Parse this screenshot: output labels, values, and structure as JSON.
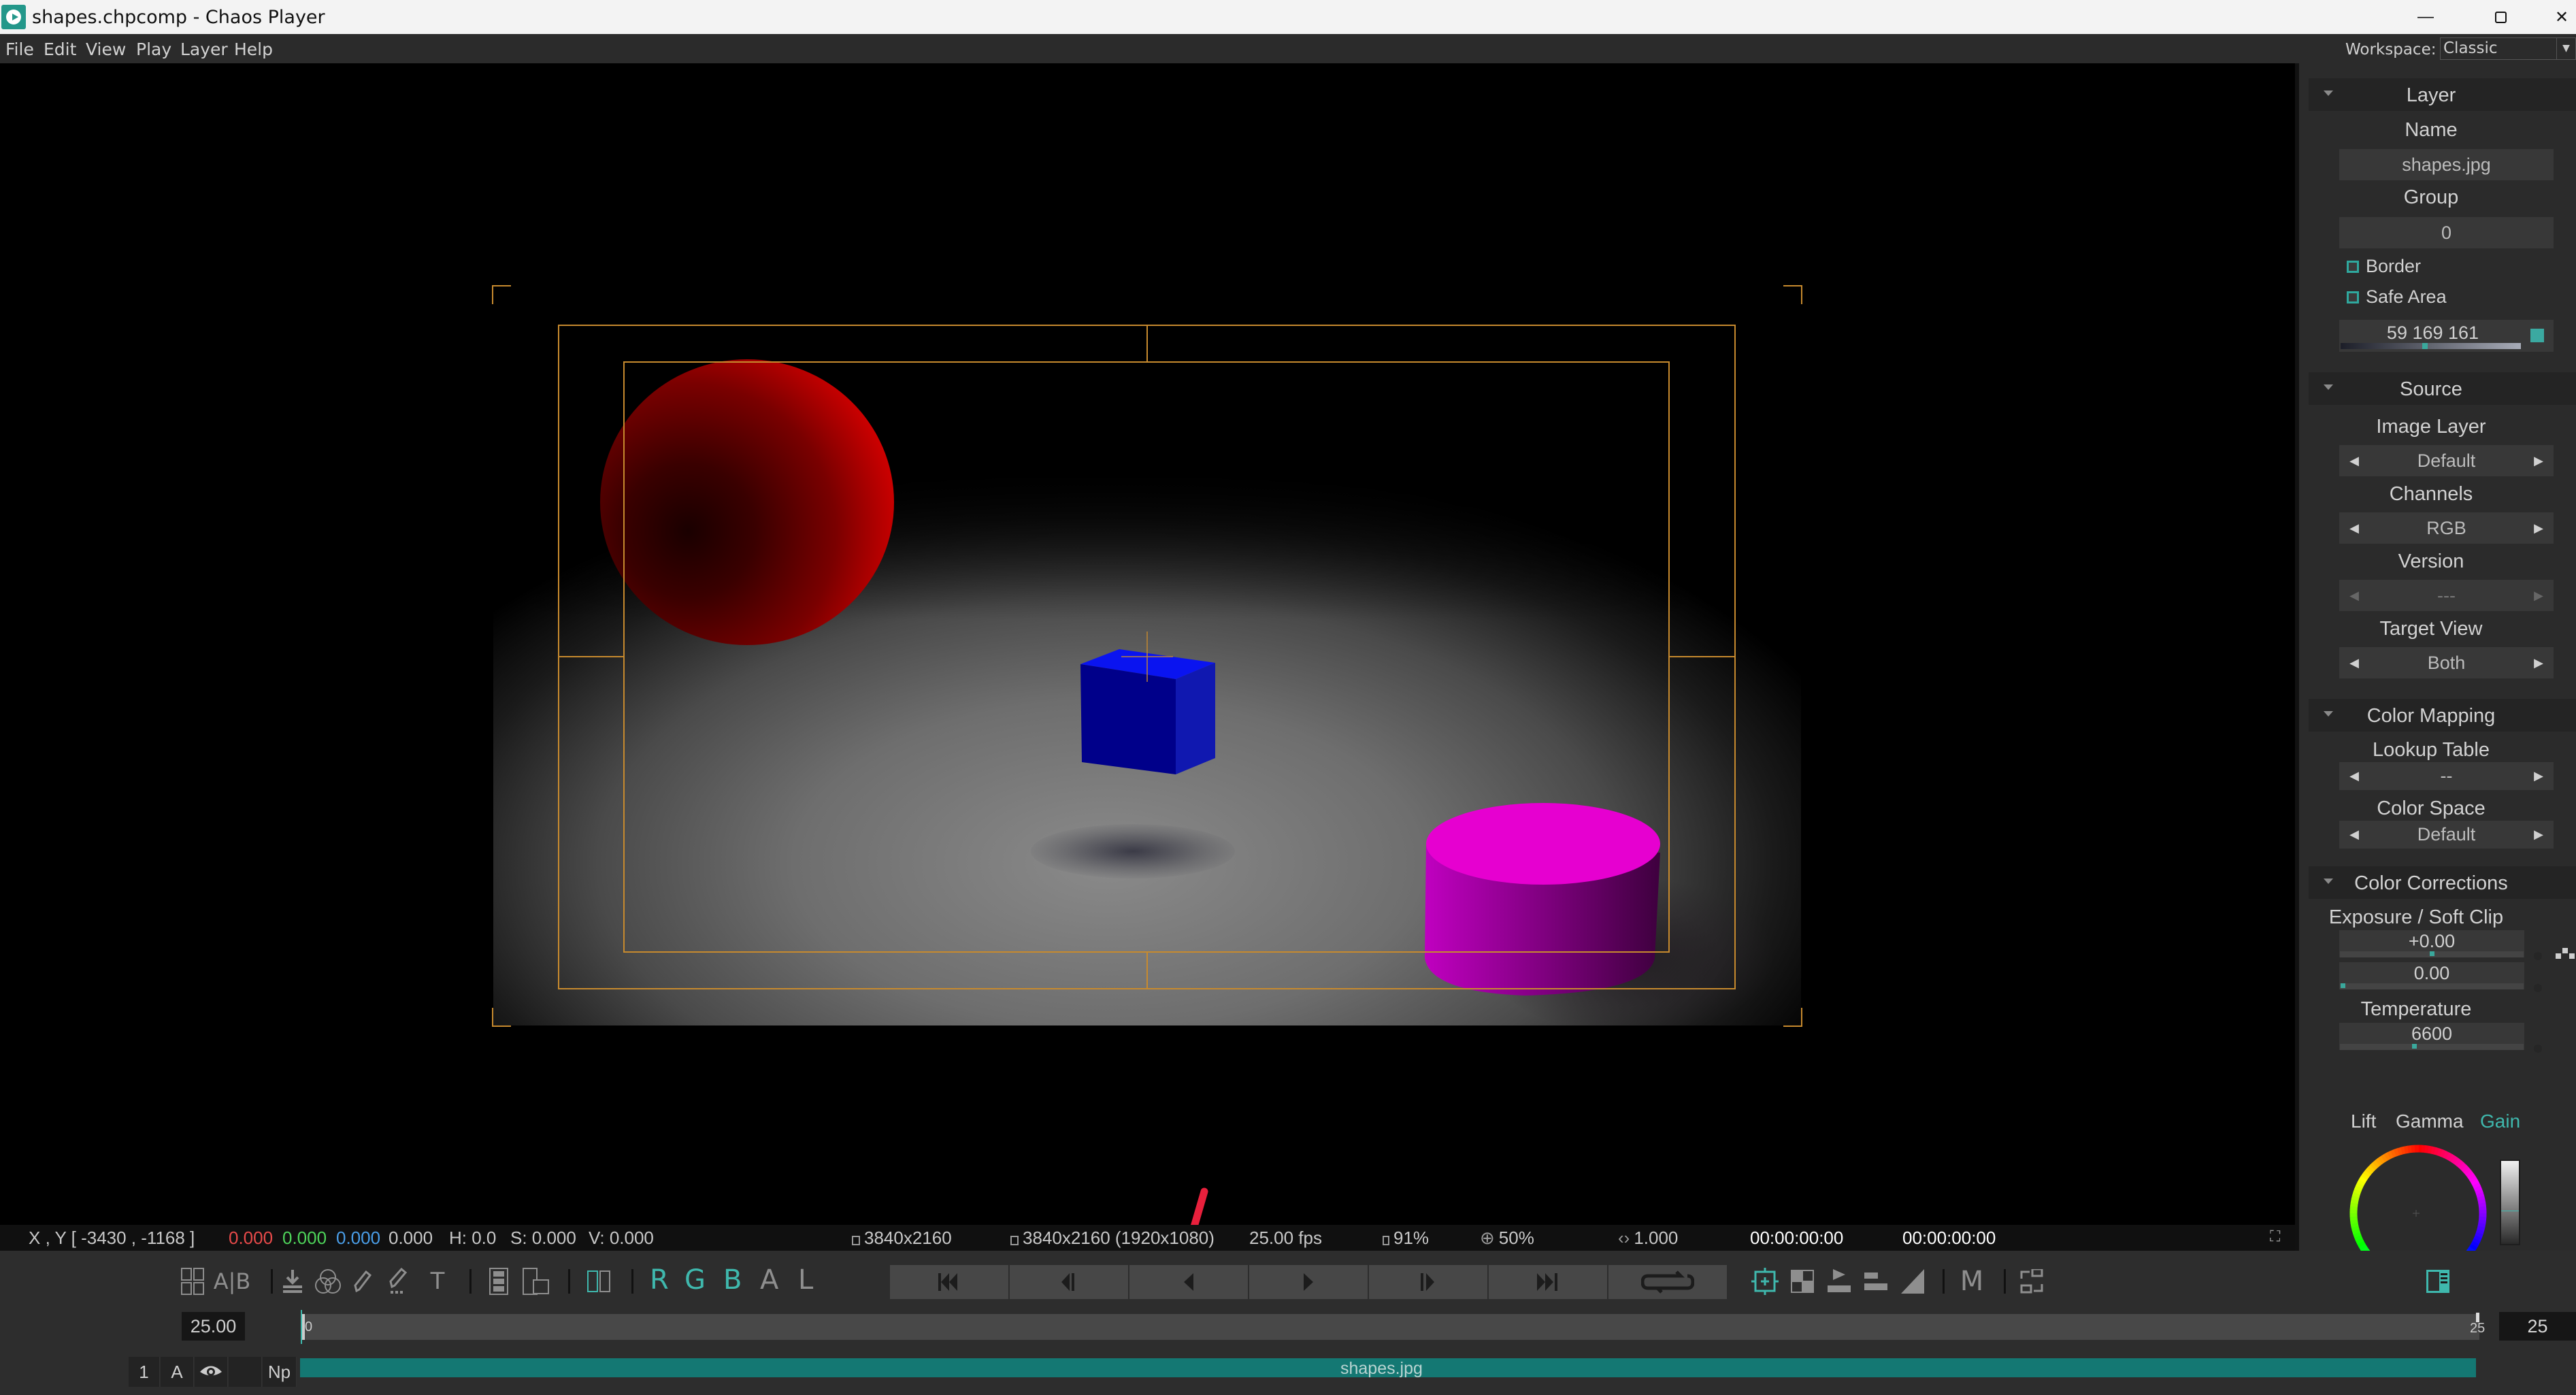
{
  "window": {
    "title": "shapes.chpcomp - Chaos Player",
    "controls": [
      "minimize",
      "restore",
      "close"
    ]
  },
  "menu": {
    "items": [
      "File",
      "Edit",
      "View",
      "Play",
      "Layer",
      "Help"
    ],
    "workspace_label": "Workspace:",
    "workspace_value": "Classic"
  },
  "viewer": {
    "annotation": "red-arrow-pointing-to-resolution"
  },
  "status": {
    "xy": "X , Y  [ -3430 , -1168 ]",
    "r": "0.000",
    "g": "0.000",
    "b": "0.000",
    "a": "0.000",
    "h": "H: 0.0",
    "s": "S: 0.000",
    "v": "V: 0.000",
    "source_res": "3840x2160",
    "display_res": "3840x2160 (1920x1080)",
    "fps": "25.00 fps",
    "cache": "91%",
    "zoom": "50%",
    "pixel_aspect": "1.000",
    "timecode_current": "00:00:00:00",
    "timecode_end": "00:00:00:00",
    "colors": {
      "r": "#e84a4a",
      "g": "#4ed45a",
      "b": "#4a9ee8"
    }
  },
  "toolbar": {
    "left_icons": [
      "compare-grid-icon",
      "ab-compare-icon",
      "import-icon",
      "color-blend-icon",
      "pencil-icon",
      "pencil-dotted-icon",
      "text-icon",
      "film-strip-icon",
      "film-overlay-icon",
      "split-view-icon"
    ],
    "ab_label": "A|B",
    "text_tool_label": "T",
    "channels": [
      {
        "label": "R",
        "active": true
      },
      {
        "label": "G",
        "active": true
      },
      {
        "label": "B",
        "active": true
      },
      {
        "label": "A",
        "active": false
      },
      {
        "label": "L",
        "active": false
      }
    ],
    "transport": [
      "skip-to-start",
      "step-back",
      "play-reverse",
      "play-forward",
      "step-forward",
      "skip-to-end",
      "loop"
    ],
    "right_icons": [
      "safe-area-icon",
      "checker-icon",
      "play-range-icon",
      "stack-icon",
      "ramp-icon"
    ],
    "m_label": "M",
    "accent": "#3fb8ad"
  },
  "timeline": {
    "fps_value": "25.00",
    "start_frame": "0",
    "end_frame_label": "25",
    "end_frame_box": "25",
    "layer": {
      "index": "1",
      "mode": "A",
      "label_np": "Np",
      "clip_name": "shapes.jpg"
    }
  },
  "panel": {
    "layer": {
      "title": "Layer",
      "name_label": "Name",
      "name_value": "shapes.jpg",
      "group_label": "Group",
      "group_value": "0",
      "border_label": "Border",
      "safe_area_label": "Safe Area",
      "color_value": "59 169 161",
      "color_swatch": "#3ba9a1"
    },
    "source": {
      "title": "Source",
      "image_layer_label": "Image Layer",
      "image_layer_value": "Default",
      "channels_label": "Channels",
      "channels_value": "RGB",
      "version_label": "Version",
      "version_value": "---",
      "target_view_label": "Target View",
      "target_view_value": "Both"
    },
    "color_mapping": {
      "title": "Color Mapping",
      "lut_label": "Lookup Table",
      "lut_value": "--",
      "color_space_label": "Color Space",
      "color_space_value": "Default"
    },
    "color_corrections": {
      "title": "Color Corrections",
      "exposure_label": "Exposure / Soft Clip",
      "exposure_value": "+0.00",
      "exposure_fraction": 0.5,
      "soft_clip_value": "0.00",
      "soft_clip_fraction": 0.0,
      "temperature_label": "Temperature",
      "temperature_value": "6600",
      "temperature_fraction": 0.4,
      "wheel_tabs": [
        "Lift",
        "Gamma",
        "Gain"
      ],
      "active_wheel": "Gain"
    }
  }
}
